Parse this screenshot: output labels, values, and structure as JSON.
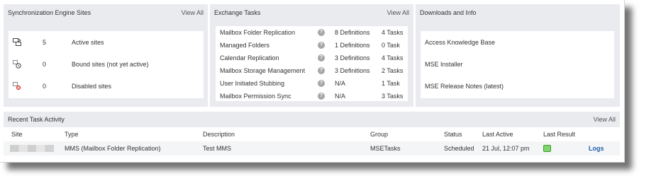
{
  "sync": {
    "title": "Synchronization Engine Sites",
    "view_all": "View All",
    "rows": [
      {
        "icon": "active-sites-icon",
        "count": "5",
        "label": "Active sites"
      },
      {
        "icon": "bound-sites-icon",
        "count": "0",
        "label": "Bound sites (not yet active)"
      },
      {
        "icon": "disabled-sites-icon",
        "count": "0",
        "label": "Disabled sites"
      }
    ]
  },
  "exchange": {
    "title": "Exchange Tasks",
    "view_all": "View All",
    "help_glyph": "?",
    "rows": [
      {
        "name": "Mailbox Folder Replication",
        "definitions": "8 Definitions",
        "tasks": "4 Tasks"
      },
      {
        "name": "Managed Folders",
        "definitions": "1 Definitions",
        "tasks": "0 Task"
      },
      {
        "name": "Calendar Replication",
        "definitions": "3 Definitions",
        "tasks": "4 Tasks"
      },
      {
        "name": "Mailbox Storage Management",
        "definitions": "3 Definitions",
        "tasks": "2 Tasks"
      },
      {
        "name": "User Initiated Stubbing",
        "definitions": "N/A",
        "tasks": "1 Task"
      },
      {
        "name": "Mailbox Permission Sync",
        "definitions": "N/A",
        "tasks": "3 Tasks"
      }
    ]
  },
  "downloads": {
    "title": "Downloads and Info",
    "items": [
      "Access Knowledge Base",
      "MSE Installer",
      "MSE Release Notes (latest)"
    ]
  },
  "recent": {
    "title": "Recent Task Activity",
    "view_all": "View All",
    "headers": {
      "site": "Site",
      "type": "Type",
      "description": "Description",
      "group": "Group",
      "status": "Status",
      "last_active": "Last Active",
      "last_result": "Last Result"
    },
    "rows": [
      {
        "type": "MMS (Mailbox Folder Replication)",
        "description": "Test MMS",
        "group": "MSETasks",
        "status": "Scheduled",
        "last_active": "21 Jul, 12:07 pm",
        "logs": "Logs",
        "result_color": "#7fd66b"
      }
    ]
  }
}
